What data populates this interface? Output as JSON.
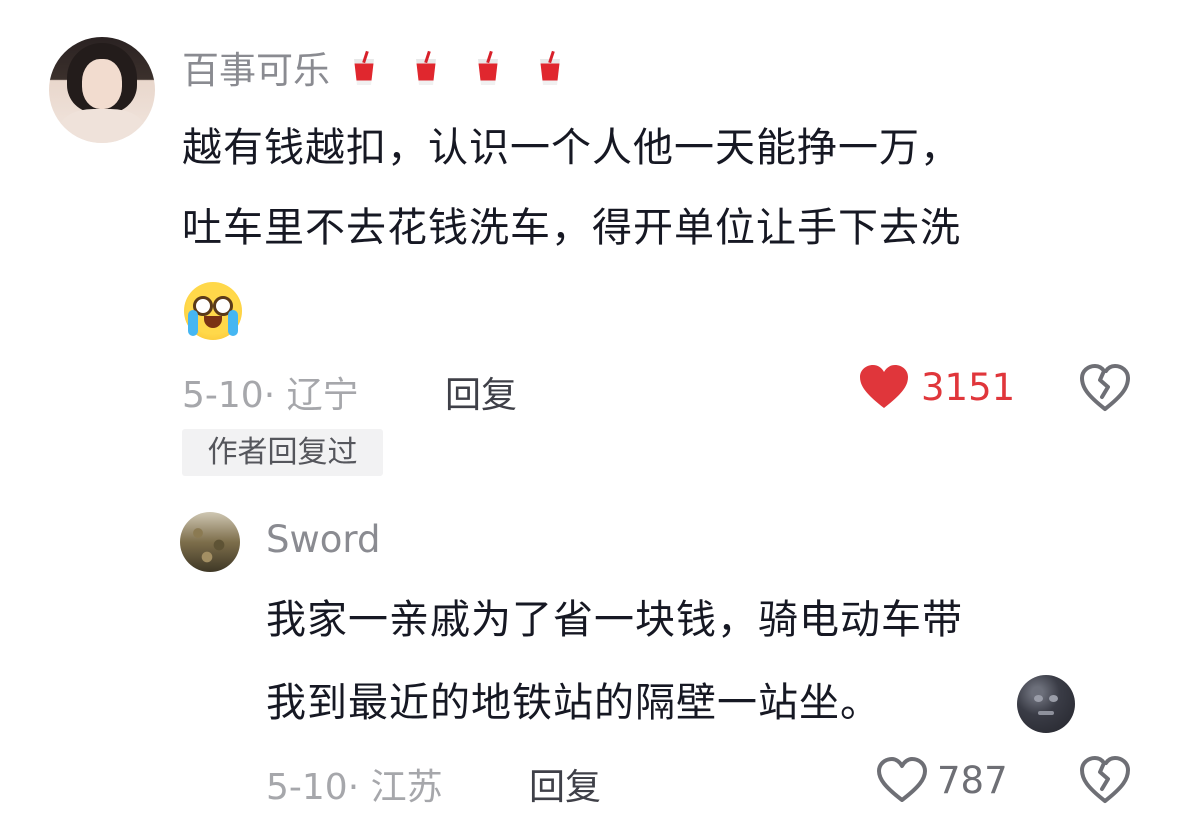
{
  "comment": {
    "username": "百事可乐",
    "username_emoji_count": 4,
    "text_lines": [
      "越有钱越扣，认识一个人他一天能挣一万，",
      "吐车里不去花钱洗车，得开单位让手下去洗"
    ],
    "emoji": "loudly-crying-face",
    "date_location": "5-10· 辽宁",
    "reply_label": "回复",
    "likes": "3151",
    "liked": true,
    "author_tag": "作者回复过"
  },
  "reply": {
    "username": "Sword",
    "text_lines": [
      "我家一亲戚为了省一块钱，骑电动车带",
      "我到最近的地铁站的隔壁一站坐。"
    ],
    "emoji": "new-moon-face",
    "date_location": "5-10· 江苏",
    "reply_label": "回复",
    "likes": "787",
    "liked": false
  },
  "colors": {
    "like_red": "#e0363b",
    "text": "#161823",
    "meta": "#a6a7ab"
  }
}
